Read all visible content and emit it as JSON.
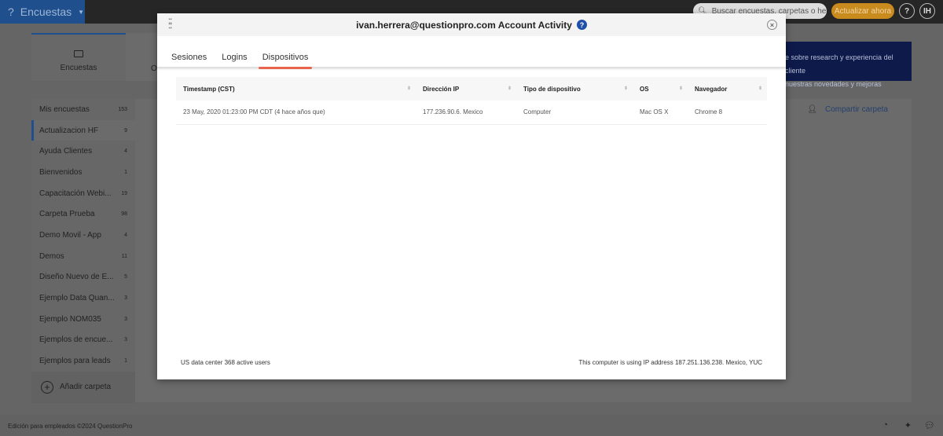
{
  "topbar": {
    "brand": "Encuestas",
    "search_placeholder": "Buscar encuestas, carpetas o herrami",
    "upgrade": "Actualizar ahora",
    "help": "?",
    "avatar": "IH"
  },
  "page": {
    "tab_encuestas": "Encuestas",
    "tab_other": "O",
    "banner_line1": "e sobre research y experiencia del cliente",
    "banner_line2": "nuestras novedades y mejoras",
    "share_folder": "Compartir carpeta",
    "add_folder": "Añadir carpeta",
    "footer": "Edición para empleados ©2024 QuestionPro"
  },
  "sidebar": {
    "items": [
      {
        "label": "Mis encuestas",
        "count": "153"
      },
      {
        "label": "Actualizacion HF",
        "count": "9"
      },
      {
        "label": "Ayuda Clientes",
        "count": "4"
      },
      {
        "label": "Bienvenidos",
        "count": "1"
      },
      {
        "label": "Capacitación Webi...",
        "count": "19"
      },
      {
        "label": "Carpeta Prueba",
        "count": "98"
      },
      {
        "label": "Demo Movil - App",
        "count": "4"
      },
      {
        "label": "Demos",
        "count": "11"
      },
      {
        "label": "Diseño Nuevo de E...",
        "count": "5"
      },
      {
        "label": "Ejemplo Data Quan...",
        "count": "3"
      },
      {
        "label": "Ejemplo NOM035",
        "count": "3"
      },
      {
        "label": "Ejemplos de encue...",
        "count": "3"
      },
      {
        "label": "Ejemplos para leads",
        "count": "1"
      }
    ]
  },
  "modal": {
    "title": "ivan.herrera@questionpro.com Account Activity",
    "tabs": [
      "Sesiones",
      "Logins",
      "Dispositivos"
    ],
    "columns": [
      "Timestamp (CST)",
      "Dirección IP",
      "Tipo de dispositivo",
      "OS",
      "Navegador"
    ],
    "rows": [
      [
        "23 May, 2020 01:23:00 PM CDT (4 hace años que)",
        "177.236.90.6. Mexico",
        "Computer",
        "Mac OS X",
        "Chrome 8"
      ]
    ],
    "footer_left": "US data center 368 active users",
    "footer_right": "This computer is using IP address 187.251.136.238. Mexico, YUC"
  }
}
